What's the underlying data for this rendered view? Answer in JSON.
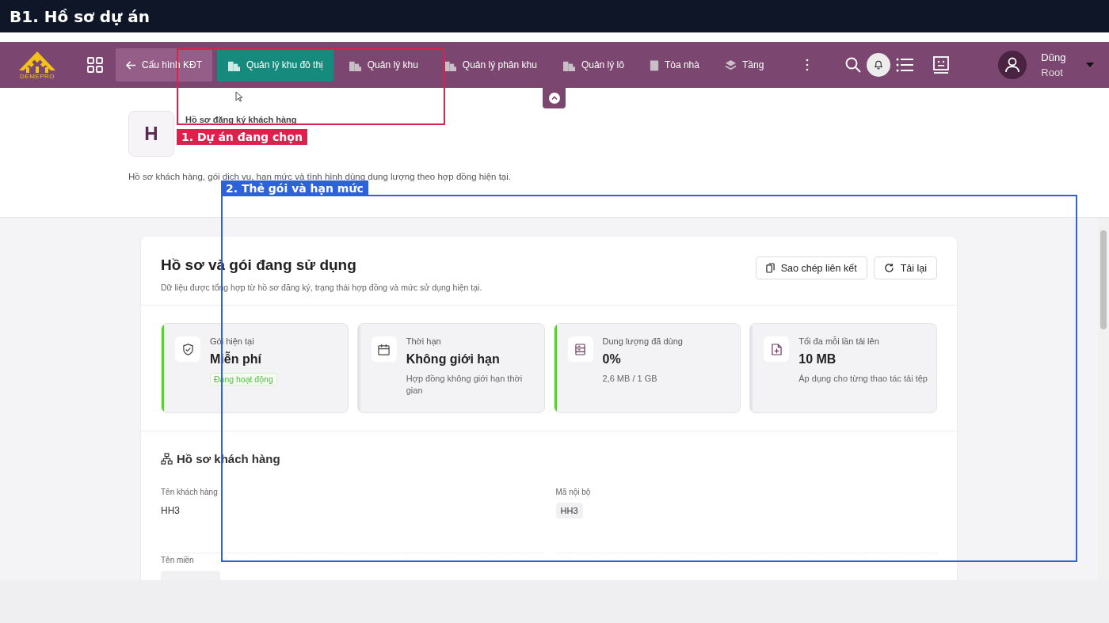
{
  "annotation_title": "B1. Hồ sơ dự án",
  "nav": {
    "logo": "DEMEPRO",
    "items": [
      {
        "label": "Cấu hình KĐT",
        "kind": "back",
        "selected": false
      },
      {
        "label": "Quản lý khu đô thị",
        "kind": "city",
        "selected": true
      },
      {
        "label": "Quản lý khu",
        "kind": "city",
        "selected": false
      },
      {
        "label": "Quản lý phân khu",
        "kind": "city",
        "selected": false
      },
      {
        "label": "Quản lý lô",
        "kind": "city",
        "selected": false
      },
      {
        "label": "Tòa nhà",
        "kind": "building",
        "selected": false
      },
      {
        "label": "Tầng",
        "kind": "layers",
        "selected": false
      }
    ],
    "user": {
      "name": "Dũng",
      "role": "Root"
    }
  },
  "header": {
    "avatar_letter": "H",
    "eyebrow": "Hồ sơ đăng ký khách hàng",
    "description": "Hồ sơ khách hàng, gói dịch vụ, hạn mức và tình hình dùng dung lượng theo hợp đồng hiện tại."
  },
  "card": {
    "title": "Hồ sơ và gói đang sử dụng",
    "subtitle": "Dữ liệu được tổng hợp từ hồ sơ đăng ký, trạng thái hợp đồng và mức sử dụng hiện tại.",
    "buttons": [
      {
        "label": "Sao chép liên kết",
        "kind": "copy"
      },
      {
        "label": "Tải lại",
        "kind": "reload"
      }
    ],
    "stats": [
      {
        "label": "Gói hiện tại",
        "value": "Miễn phí",
        "kind": "shield",
        "highlighted": true,
        "badge": "Đang hoạt động"
      },
      {
        "label": "Thời hạn",
        "value": "Không giới hạn",
        "kind": "calendar",
        "highlighted": false,
        "note": "Hợp đồng không giới hạn thời gian"
      },
      {
        "label": "Dung lượng đã dùng",
        "value": "0%",
        "kind": "storage",
        "highlighted": true,
        "note": "2,6 MB / 1 GB"
      },
      {
        "label": "Tối đa mỗi lần tải lên",
        "value": "10 MB",
        "kind": "file",
        "highlighted": false,
        "note": "Áp dụng cho từng thao tác tải tệp"
      }
    ],
    "section": {
      "title": "Hồ sơ khách hàng",
      "fields": [
        {
          "label": "Tên khách hàng",
          "value": "HH3",
          "kind": "text"
        },
        {
          "label": "Mã nội bộ",
          "value": "HH3",
          "kind": "tag"
        },
        {
          "label": "Tên miền",
          "kind": "tag"
        }
      ]
    }
  },
  "annotations": [
    {
      "label": "1. Dự án đang chọn",
      "color": "#df1f4c"
    },
    {
      "label": "2. Thẻ gói và hạn mức",
      "color": "#2d62d8"
    }
  ]
}
